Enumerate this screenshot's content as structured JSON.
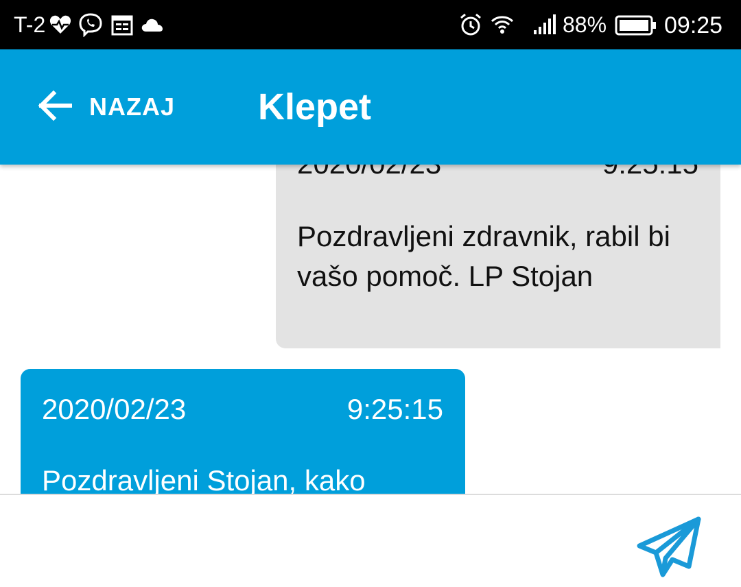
{
  "status_bar": {
    "carrier": "T-2",
    "icons": [
      "heart-rate-icon",
      "viber-icon",
      "calendar-icon",
      "cloud-icon",
      "alarm-icon",
      "wifi-icon",
      "signal-icon",
      "battery-icon"
    ],
    "battery_percent": "88%",
    "time": "09:25"
  },
  "app_bar": {
    "back_label": "NAZAJ",
    "title": "Klepet",
    "color": "#009fdb"
  },
  "messages": [
    {
      "direction": "incoming",
      "date": "2020/02/23",
      "time": "9:25:15",
      "text": "Pozdravljeni zdravnik, rabil bi vašo pomoč. LP Stojan",
      "color": "#e3e3e3"
    },
    {
      "direction": "outgoing",
      "date": "2020/02/23",
      "time": "9:25:15",
      "text": "Pozdravljeni Stojan, kako",
      "color": "#009fdb"
    }
  ],
  "composer": {
    "value": "",
    "placeholder": "",
    "send_icon": "send-icon"
  }
}
